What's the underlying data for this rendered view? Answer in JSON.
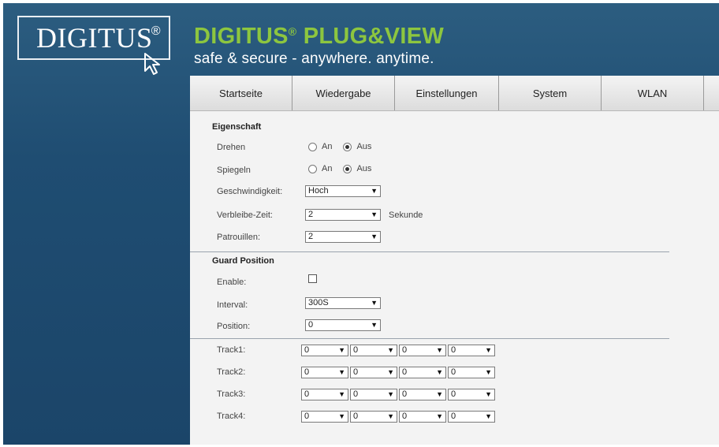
{
  "brand": {
    "logo_text": "DIGITUS",
    "logo_mark": "®",
    "title_main": "DIGITUS",
    "title_mark": "®",
    "title_product": "PLUG&VIEW",
    "tagline": "safe & secure - anywhere. anytime.",
    "accent_color": "#8dc63f",
    "banner_color": "#1f4d72"
  },
  "tabs": [
    {
      "label": "Startseite"
    },
    {
      "label": "Wiedergabe"
    },
    {
      "label": "Einstellungen"
    },
    {
      "label": "System"
    },
    {
      "label": "WLAN"
    }
  ],
  "eigenschaft": {
    "title": "Eigenschaft",
    "drehen": {
      "label": "Drehen",
      "options": [
        "An",
        "Aus"
      ],
      "selected": "Aus"
    },
    "spiegeln": {
      "label": "Spiegeln",
      "options": [
        "An",
        "Aus"
      ],
      "selected": "Aus"
    },
    "geschwindigkeit": {
      "label": "Geschwindigkeit:",
      "value": "Hoch"
    },
    "verbleibe_zeit": {
      "label": "Verbleibe-Zeit:",
      "value": "2",
      "unit": "Sekunde"
    },
    "patrouillen": {
      "label": "Patrouillen:",
      "value": "2"
    }
  },
  "guard": {
    "title": "Guard Position",
    "enable": {
      "label": "Enable:",
      "checked": false
    },
    "interval": {
      "label": "Interval:",
      "value": "300S"
    },
    "position": {
      "label": "Position:",
      "value": "0"
    }
  },
  "tracks": [
    {
      "label": "Track1:",
      "values": [
        "0",
        "0",
        "0",
        "0"
      ]
    },
    {
      "label": "Track2:",
      "values": [
        "0",
        "0",
        "0",
        "0"
      ]
    },
    {
      "label": "Track3:",
      "values": [
        "0",
        "0",
        "0",
        "0"
      ]
    },
    {
      "label": "Track4:",
      "values": [
        "0",
        "0",
        "0",
        "0"
      ]
    }
  ]
}
